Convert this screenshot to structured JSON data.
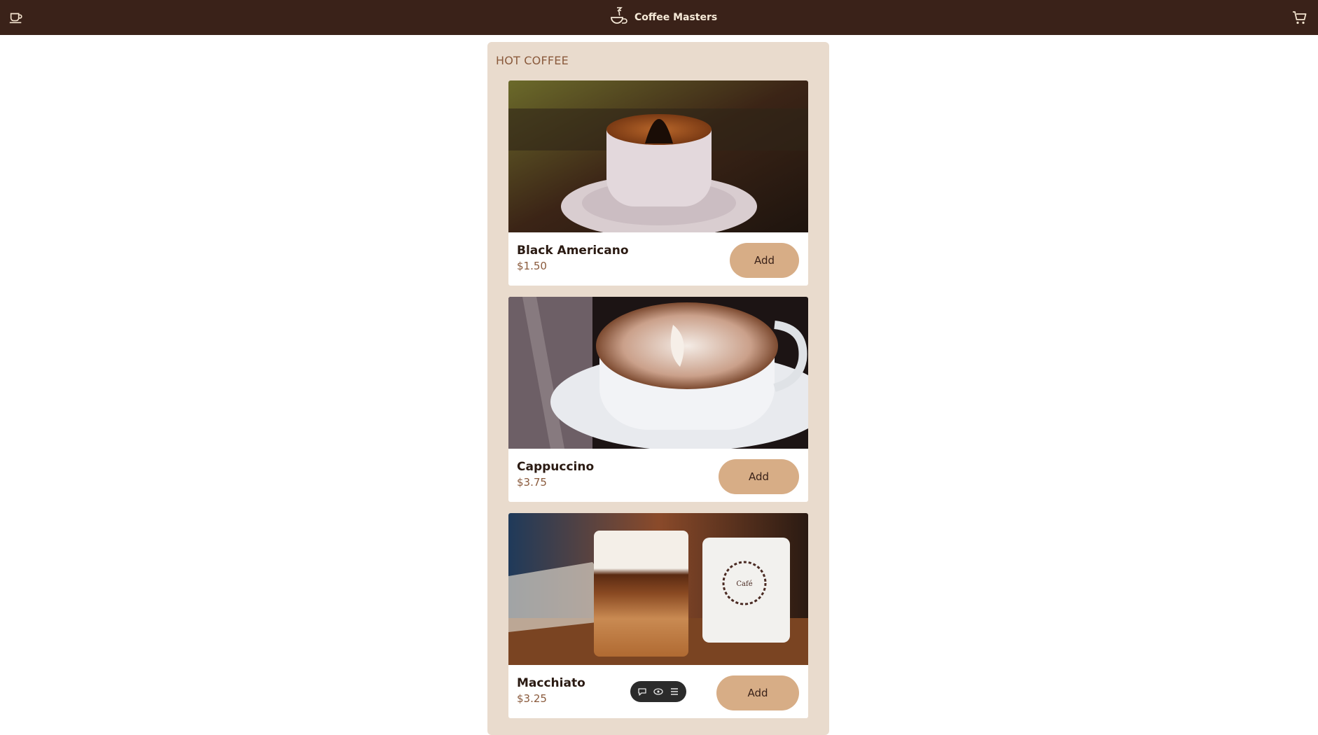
{
  "header": {
    "title": "Coffee Masters",
    "menu_icon": "coffee-cup-icon",
    "cart_icon": "shopping-cart-icon",
    "colors": {
      "bar": "#3a2219",
      "text": "#f6ead8"
    }
  },
  "category": {
    "title": "HOT COFFEE",
    "colors": {
      "panel": "#e9dbcd",
      "title": "#8a5a3c",
      "button": "#d7ad86"
    }
  },
  "products": [
    {
      "name": "Black Americano",
      "price": "$1.50",
      "add_label": "Add"
    },
    {
      "name": "Cappuccino",
      "price": "$3.75",
      "add_label": "Add"
    },
    {
      "name": "Macchiato",
      "price": "$3.25",
      "add_label": "Add"
    }
  ],
  "toolbar": {
    "icons": [
      "comment-icon",
      "eye-icon",
      "menu-icon"
    ]
  }
}
